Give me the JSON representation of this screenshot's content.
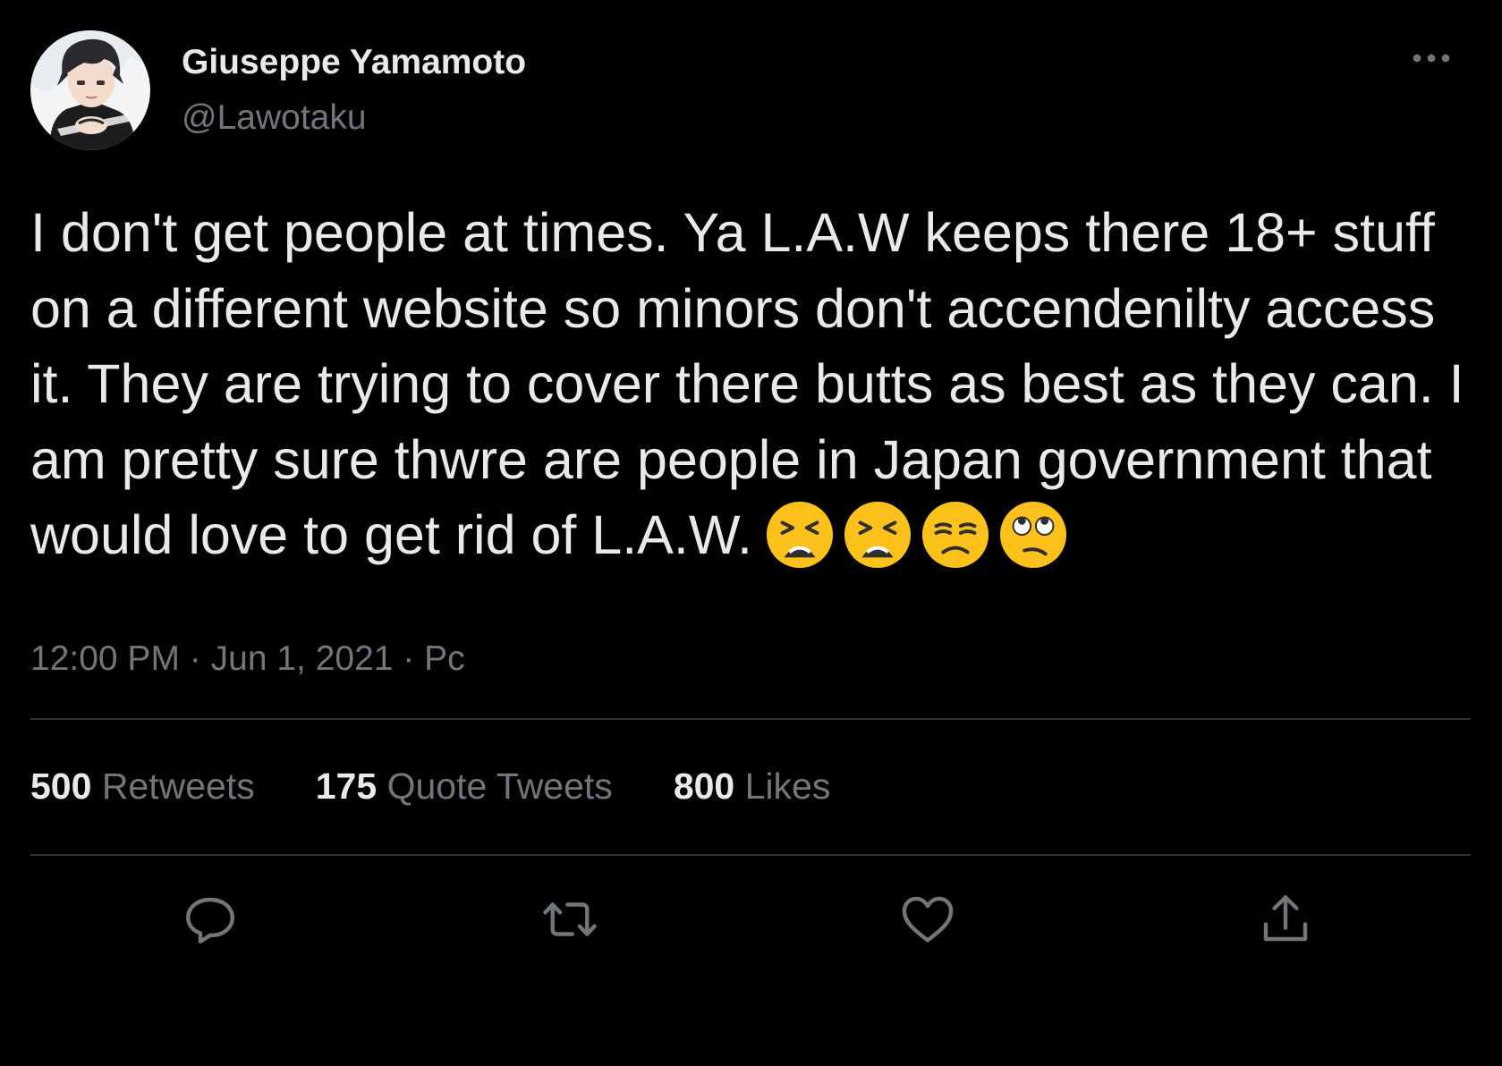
{
  "colors": {
    "background": "#000000",
    "text_primary": "#e7e9ea",
    "text_secondary": "#71767b",
    "divider": "#2f3336"
  },
  "author": {
    "display_name": "Giuseppe Yamamoto",
    "handle": "@Lawotaku",
    "avatar_icon": "anime-character-avatar"
  },
  "tweet": {
    "text": "I don't get people at times. Ya L.A.W keeps there 18+ stuff on a different website so minors don't accendenilty access it. They are trying to cover there butts as best as they can. I am pretty sure thwre are people in Japan government that would love to get rid of L.A.W.",
    "emojis": [
      "tired-face-emoji",
      "tired-face-emoji",
      "unamused-face-emoji",
      "eye-roll-emoji"
    ],
    "time": "12:00 PM",
    "date": "Jun 1, 2021",
    "source": "Pc",
    "separator": "·"
  },
  "stats": {
    "retweets_count": "500",
    "retweets_label": "Retweets",
    "quotes_count": "175",
    "quotes_label": "Quote Tweets",
    "likes_count": "800",
    "likes_label": "Likes"
  },
  "actions": {
    "reply_icon": "reply-icon",
    "retweet_icon": "retweet-icon",
    "like_icon": "heart-icon",
    "share_icon": "share-icon",
    "more_icon": "more-horizontal-icon"
  }
}
